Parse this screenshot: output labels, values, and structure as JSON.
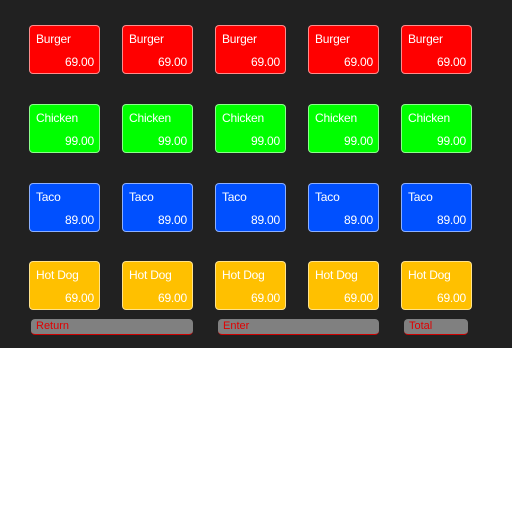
{
  "menu": {
    "rows": [
      {
        "label": "Burger",
        "price": "69.00",
        "color": "#ff0000"
      },
      {
        "label": "Chicken",
        "price": "99.00",
        "color": "#00ff00"
      },
      {
        "label": "Taco",
        "price": "89.00",
        "color": "#0050ff"
      },
      {
        "label": "Hot Dog",
        "price": "69.00",
        "color": "#ffc000"
      }
    ],
    "columns": 5
  },
  "actions": {
    "return_label": "Return",
    "enter_label": "Enter",
    "total_label": "Total"
  }
}
